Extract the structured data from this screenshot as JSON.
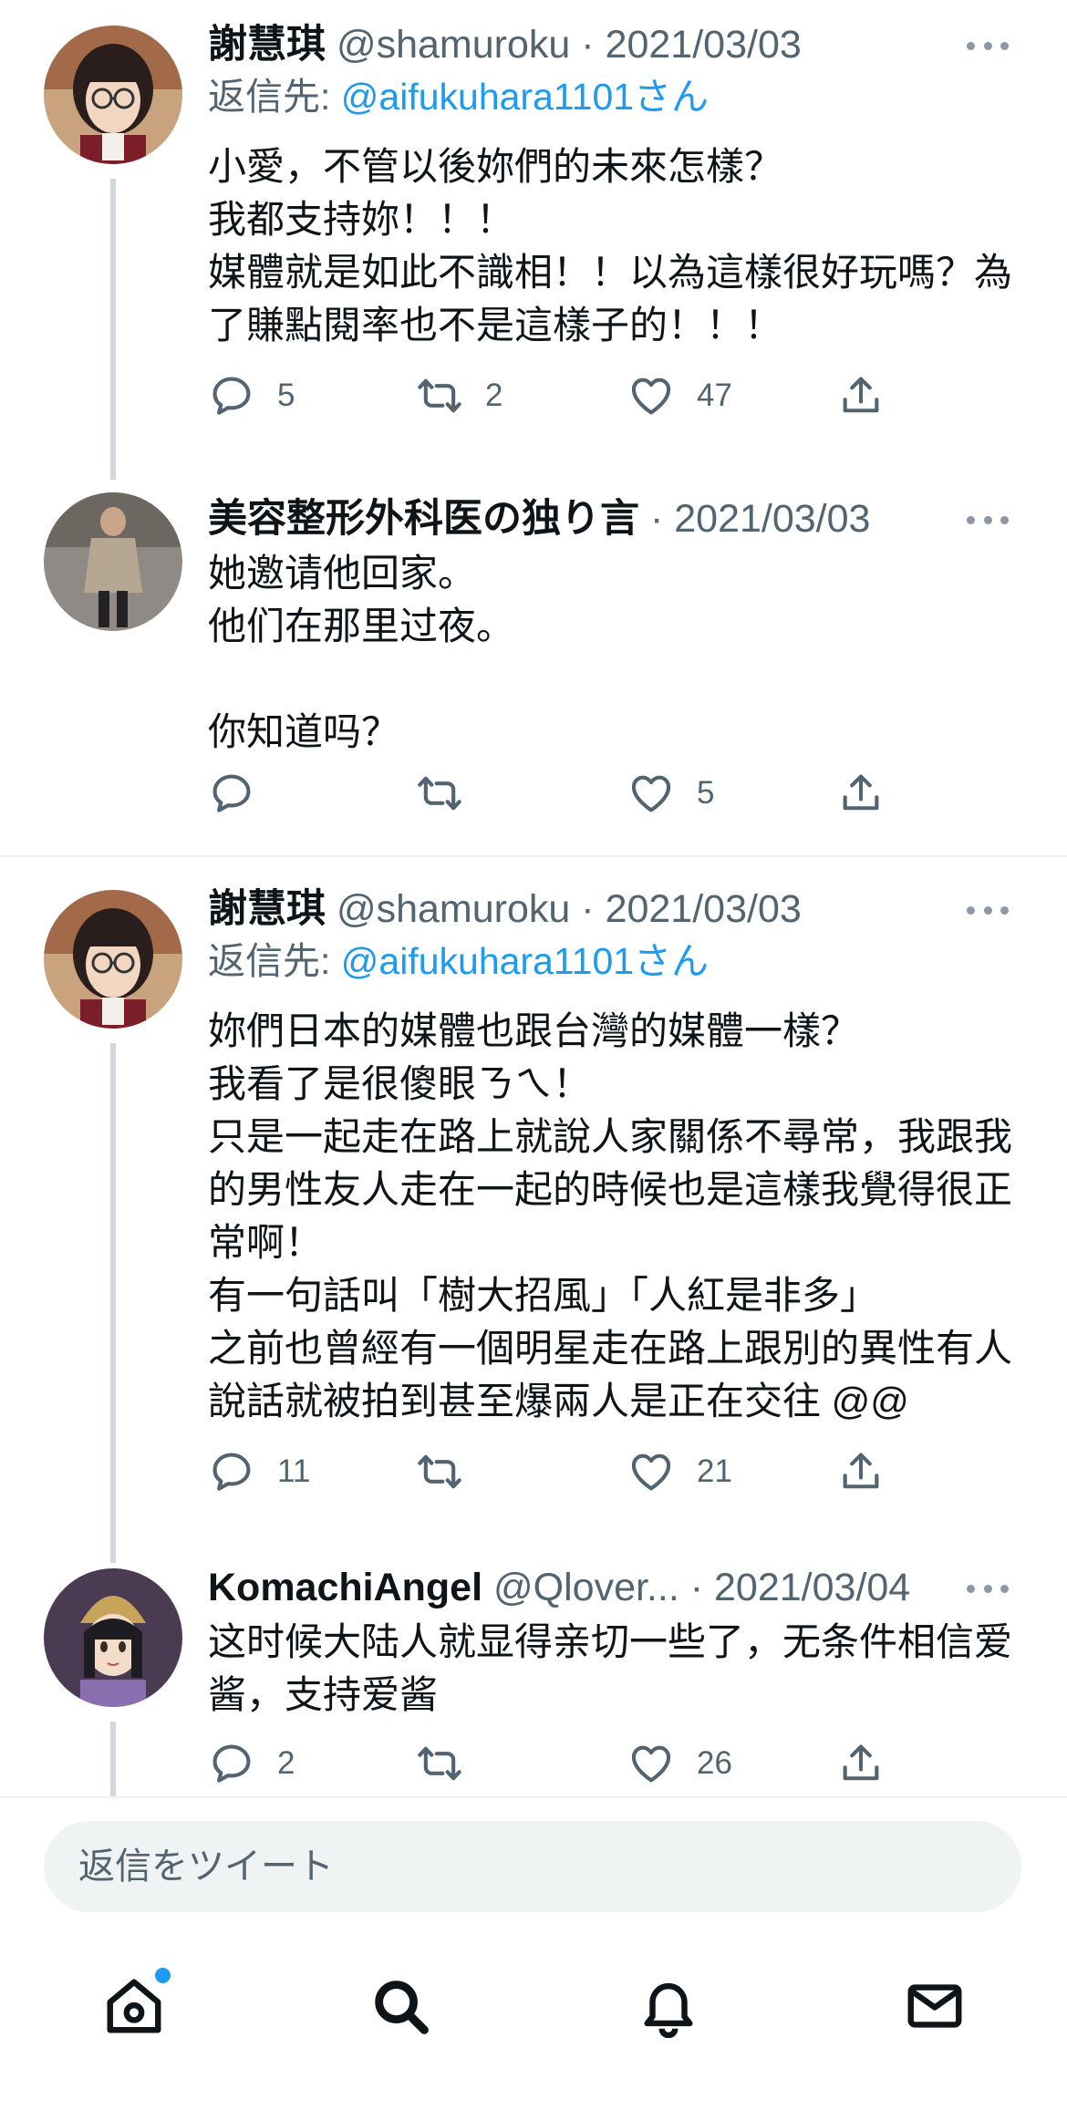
{
  "colors": {
    "accent": "#1d9bf0",
    "text": "#0f1419",
    "secondary": "#536471",
    "thread_line": "#cfd9de"
  },
  "tweets": [
    {
      "name": "謝慧琪",
      "handle": "@shamuroku",
      "dot": "·",
      "date": "2021/03/03",
      "reply_prefix": "返信先: ",
      "reply_mention": "@aifukuhara1101さん",
      "text": "小愛，不管以後妳們的未來怎樣？\n我都支持妳！！！\n媒體就是如此不識相！！以為這樣很好玩嗎？為了賺點閱率也不是這樣子的！！！",
      "replies": "5",
      "retweets": "2",
      "likes": "47",
      "avatar_icon": "avatar-woman-glasses"
    },
    {
      "name": "美容整形外科医の独り言",
      "handle": "",
      "dot": "·",
      "date": "2021/03/03",
      "text": "她邀请他回家。\n他们在那里过夜。\n\n你知道吗？",
      "replies": "",
      "retweets": "",
      "likes": "5",
      "avatar_icon": "avatar-man-coat"
    },
    {
      "name": "謝慧琪",
      "handle": "@shamuroku",
      "dot": "·",
      "date": "2021/03/03",
      "reply_prefix": "返信先: ",
      "reply_mention": "@aifukuhara1101さん",
      "text": "妳們日本的媒體也跟台灣的媒體一樣？\n我看了是很傻眼ㄋㄟ！\n只是一起走在路上就說人家關係不尋常，我跟我的男性友人走在一起的時候也是這樣我覺得很正常啊！\n有一句話叫「樹大招風」「人紅是非多」\n之前也曾經有一個明星走在路上跟別的異性有人說話就被拍到甚至爆兩人是正在交往 @@",
      "replies": "11",
      "retweets": "",
      "likes": "21",
      "avatar_icon": "avatar-woman-glasses"
    },
    {
      "name": "KomachiAngel",
      "handle": "@Qlover...",
      "dot": "·",
      "date": "2021/03/04",
      "text": "这时候大陆人就显得亲切一些了，无条件相信爱酱，支持爱酱",
      "replies": "2",
      "retweets": "",
      "likes": "26",
      "avatar_icon": "avatar-anime-girl"
    }
  ],
  "composer": {
    "placeholder": "返信をツイート"
  },
  "tabbar": {
    "items": [
      {
        "icon": "home-icon",
        "has_notification_dot": true
      },
      {
        "icon": "search-icon"
      },
      {
        "icon": "bell-icon"
      },
      {
        "icon": "mail-icon"
      }
    ]
  }
}
